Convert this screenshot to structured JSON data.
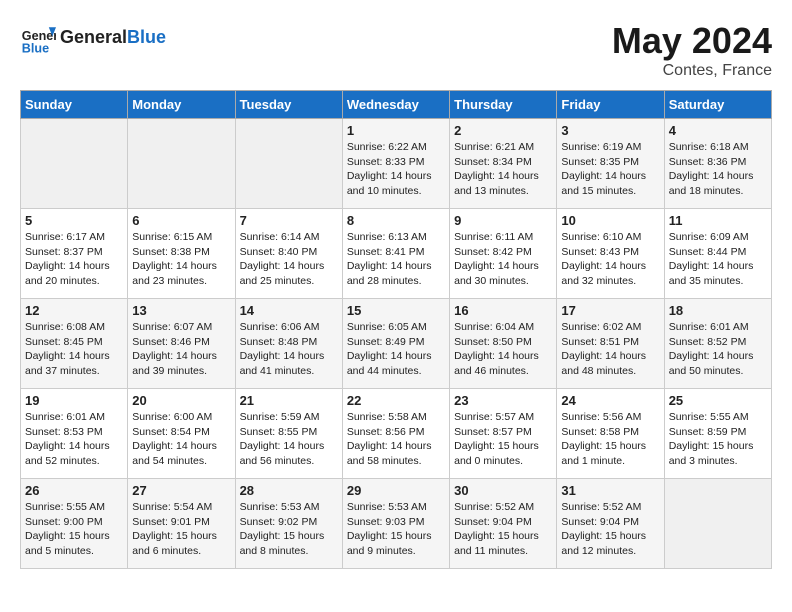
{
  "logo": {
    "general": "General",
    "blue": "Blue"
  },
  "title": "May 2024",
  "location": "Contes, France",
  "days_of_week": [
    "Sunday",
    "Monday",
    "Tuesday",
    "Wednesday",
    "Thursday",
    "Friday",
    "Saturday"
  ],
  "weeks": [
    [
      {
        "day": "",
        "info": ""
      },
      {
        "day": "",
        "info": ""
      },
      {
        "day": "",
        "info": ""
      },
      {
        "day": "1",
        "info": "Sunrise: 6:22 AM\nSunset: 8:33 PM\nDaylight: 14 hours\nand 10 minutes."
      },
      {
        "day": "2",
        "info": "Sunrise: 6:21 AM\nSunset: 8:34 PM\nDaylight: 14 hours\nand 13 minutes."
      },
      {
        "day": "3",
        "info": "Sunrise: 6:19 AM\nSunset: 8:35 PM\nDaylight: 14 hours\nand 15 minutes."
      },
      {
        "day": "4",
        "info": "Sunrise: 6:18 AM\nSunset: 8:36 PM\nDaylight: 14 hours\nand 18 minutes."
      }
    ],
    [
      {
        "day": "5",
        "info": "Sunrise: 6:17 AM\nSunset: 8:37 PM\nDaylight: 14 hours\nand 20 minutes."
      },
      {
        "day": "6",
        "info": "Sunrise: 6:15 AM\nSunset: 8:38 PM\nDaylight: 14 hours\nand 23 minutes."
      },
      {
        "day": "7",
        "info": "Sunrise: 6:14 AM\nSunset: 8:40 PM\nDaylight: 14 hours\nand 25 minutes."
      },
      {
        "day": "8",
        "info": "Sunrise: 6:13 AM\nSunset: 8:41 PM\nDaylight: 14 hours\nand 28 minutes."
      },
      {
        "day": "9",
        "info": "Sunrise: 6:11 AM\nSunset: 8:42 PM\nDaylight: 14 hours\nand 30 minutes."
      },
      {
        "day": "10",
        "info": "Sunrise: 6:10 AM\nSunset: 8:43 PM\nDaylight: 14 hours\nand 32 minutes."
      },
      {
        "day": "11",
        "info": "Sunrise: 6:09 AM\nSunset: 8:44 PM\nDaylight: 14 hours\nand 35 minutes."
      }
    ],
    [
      {
        "day": "12",
        "info": "Sunrise: 6:08 AM\nSunset: 8:45 PM\nDaylight: 14 hours\nand 37 minutes."
      },
      {
        "day": "13",
        "info": "Sunrise: 6:07 AM\nSunset: 8:46 PM\nDaylight: 14 hours\nand 39 minutes."
      },
      {
        "day": "14",
        "info": "Sunrise: 6:06 AM\nSunset: 8:48 PM\nDaylight: 14 hours\nand 41 minutes."
      },
      {
        "day": "15",
        "info": "Sunrise: 6:05 AM\nSunset: 8:49 PM\nDaylight: 14 hours\nand 44 minutes."
      },
      {
        "day": "16",
        "info": "Sunrise: 6:04 AM\nSunset: 8:50 PM\nDaylight: 14 hours\nand 46 minutes."
      },
      {
        "day": "17",
        "info": "Sunrise: 6:02 AM\nSunset: 8:51 PM\nDaylight: 14 hours\nand 48 minutes."
      },
      {
        "day": "18",
        "info": "Sunrise: 6:01 AM\nSunset: 8:52 PM\nDaylight: 14 hours\nand 50 minutes."
      }
    ],
    [
      {
        "day": "19",
        "info": "Sunrise: 6:01 AM\nSunset: 8:53 PM\nDaylight: 14 hours\nand 52 minutes."
      },
      {
        "day": "20",
        "info": "Sunrise: 6:00 AM\nSunset: 8:54 PM\nDaylight: 14 hours\nand 54 minutes."
      },
      {
        "day": "21",
        "info": "Sunrise: 5:59 AM\nSunset: 8:55 PM\nDaylight: 14 hours\nand 56 minutes."
      },
      {
        "day": "22",
        "info": "Sunrise: 5:58 AM\nSunset: 8:56 PM\nDaylight: 14 hours\nand 58 minutes."
      },
      {
        "day": "23",
        "info": "Sunrise: 5:57 AM\nSunset: 8:57 PM\nDaylight: 15 hours\nand 0 minutes."
      },
      {
        "day": "24",
        "info": "Sunrise: 5:56 AM\nSunset: 8:58 PM\nDaylight: 15 hours\nand 1 minute."
      },
      {
        "day": "25",
        "info": "Sunrise: 5:55 AM\nSunset: 8:59 PM\nDaylight: 15 hours\nand 3 minutes."
      }
    ],
    [
      {
        "day": "26",
        "info": "Sunrise: 5:55 AM\nSunset: 9:00 PM\nDaylight: 15 hours\nand 5 minutes."
      },
      {
        "day": "27",
        "info": "Sunrise: 5:54 AM\nSunset: 9:01 PM\nDaylight: 15 hours\nand 6 minutes."
      },
      {
        "day": "28",
        "info": "Sunrise: 5:53 AM\nSunset: 9:02 PM\nDaylight: 15 hours\nand 8 minutes."
      },
      {
        "day": "29",
        "info": "Sunrise: 5:53 AM\nSunset: 9:03 PM\nDaylight: 15 hours\nand 9 minutes."
      },
      {
        "day": "30",
        "info": "Sunrise: 5:52 AM\nSunset: 9:04 PM\nDaylight: 15 hours\nand 11 minutes."
      },
      {
        "day": "31",
        "info": "Sunrise: 5:52 AM\nSunset: 9:04 PM\nDaylight: 15 hours\nand 12 minutes."
      },
      {
        "day": "",
        "info": ""
      }
    ]
  ]
}
